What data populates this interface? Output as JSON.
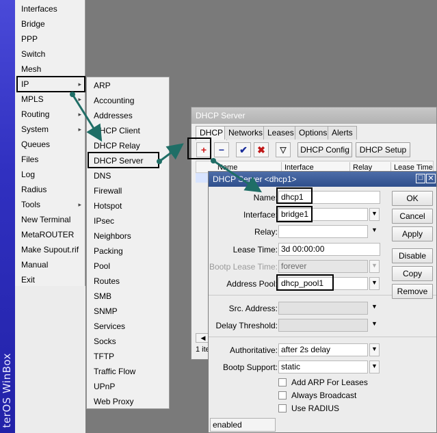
{
  "winbox": {
    "brand": "terOS WinBox"
  },
  "main_menu": {
    "items": [
      {
        "label": "Interfaces",
        "arrow": false
      },
      {
        "label": "Bridge",
        "arrow": false
      },
      {
        "label": "PPP",
        "arrow": false
      },
      {
        "label": "Switch",
        "arrow": false
      },
      {
        "label": "Mesh",
        "arrow": false
      },
      {
        "label": "IP",
        "arrow": true
      },
      {
        "label": "MPLS",
        "arrow": true
      },
      {
        "label": "Routing",
        "arrow": true
      },
      {
        "label": "System",
        "arrow": true
      },
      {
        "label": "Queues",
        "arrow": false
      },
      {
        "label": "Files",
        "arrow": false
      },
      {
        "label": "Log",
        "arrow": false
      },
      {
        "label": "Radius",
        "arrow": false
      },
      {
        "label": "Tools",
        "arrow": true
      },
      {
        "label": "New Terminal",
        "arrow": false
      },
      {
        "label": "MetaROUTER",
        "arrow": false
      },
      {
        "label": "Make Supout.rif",
        "arrow": false
      },
      {
        "label": "Manual",
        "arrow": false
      },
      {
        "label": "Exit",
        "arrow": false
      }
    ]
  },
  "ip_submenu": {
    "items": [
      "ARP",
      "Accounting",
      "Addresses",
      "DHCP Client",
      "DHCP Relay",
      "DHCP Server",
      "DNS",
      "Firewall",
      "Hotspot",
      "IPsec",
      "Neighbors",
      "Packing",
      "Pool",
      "Routes",
      "SMB",
      "SNMP",
      "Services",
      "Socks",
      "TFTP",
      "Traffic Flow",
      "UPnP",
      "Web Proxy"
    ]
  },
  "dhcp_window": {
    "title": "DHCP Server",
    "tabs": [
      "DHCP",
      "Networks",
      "Leases",
      "Options",
      "Alerts"
    ],
    "toolbar": {
      "config_label": "DHCP Config",
      "setup_label": "DHCP Setup"
    },
    "columns": [
      "Name",
      "Interface",
      "Relay",
      "Lease Time"
    ],
    "footer_text": "1 ite"
  },
  "dialog": {
    "title": "DHCP Server <dhcp1>",
    "fields": {
      "name": {
        "label": "Name:",
        "value": "dhcp1"
      },
      "interface": {
        "label": "Interface:",
        "value": "bridge1"
      },
      "relay": {
        "label": "Relay:",
        "value": ""
      },
      "lease_time": {
        "label": "Lease Time:",
        "value": "3d 00:00:00"
      },
      "bootp_lease_time": {
        "label": "Bootp Lease Time:",
        "value": "forever"
      },
      "address_pool": {
        "label": "Address Pool:",
        "value": "dhcp_pool1"
      },
      "src_address": {
        "label": "Src. Address:",
        "value": ""
      },
      "delay_threshold": {
        "label": "Delay Threshold:",
        "value": ""
      },
      "authoritative": {
        "label": "Authoritative:",
        "value": "after 2s delay"
      },
      "bootp_support": {
        "label": "Bootp Support:",
        "value": "static"
      }
    },
    "checkboxes": {
      "add_arp": {
        "label": "Add ARP For Leases",
        "checked": false
      },
      "always_broadcast": {
        "label": "Always Broadcast",
        "checked": false
      },
      "use_radius": {
        "label": "Use RADIUS",
        "checked": false
      }
    },
    "buttons": {
      "ok": "OK",
      "cancel": "Cancel",
      "apply": "Apply",
      "disable": "Disable",
      "copy": "Copy",
      "remove": "Remove"
    },
    "status": "enabled"
  },
  "colors": {
    "arrow": "#1f6e66",
    "title_active": "#3a5a98"
  }
}
